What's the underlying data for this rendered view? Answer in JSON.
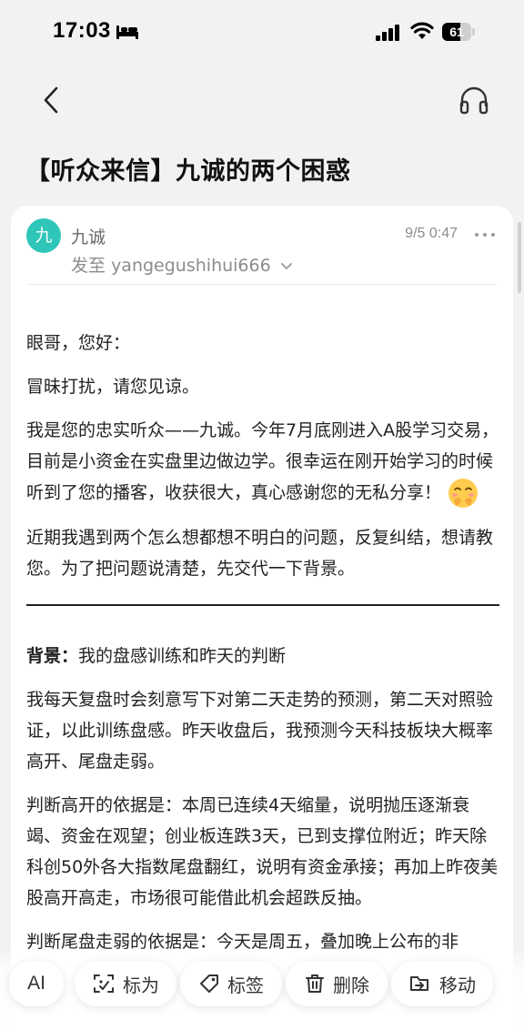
{
  "status": {
    "time": "17:03",
    "battery_percent": "61",
    "battery_level": 0.61
  },
  "header": {
    "back_icon": "chevron-left-icon",
    "audio_icon": "headphones-icon"
  },
  "title": "【听众来信】九诚的两个困惑",
  "email": {
    "avatar_letter": "九",
    "sender": "九诚",
    "recipient_prefix": "发至",
    "recipient": "yangegushihui666",
    "time": "9/5 0:47"
  },
  "body": {
    "greeting": "眼哥，您好：",
    "p1": "冒昧打扰，请您见谅。",
    "p2": "我是您的忠实听众——九诚。今年7月底刚进入A股学习交易，目前是小资金在实盘里边做边学。很幸运在刚开始学习的时候听到了您的播客，收获很大，真心感谢您的无私分享！",
    "p3": "近期我遇到两个怎么想都想不明白的问题，反复纠结，想请教您。为了把问题说清楚，先交代一下背景。",
    "bg_label": "背景：",
    "bg_title": "我的盘感训练和昨天的判断",
    "p4": "我每天复盘时会刻意写下对第二天走势的预测，第二天对照验证，以此训练盘感。昨天收盘后，我预测今天科技板块大概率高开、尾盘走弱。",
    "p5": "判断高开的依据是：本周已连续4天缩量，说明抛压逐渐衰竭、资金在观望；创业板连跌3天，已到支撑位附近；昨天除科创50外各大指数尾盘翻红，说明有资金承接；再加上昨夜美股高开高走，市场很可能借此机会超跌反抽。",
    "p6": "判断尾盘走弱的依据是：今天是周五，叠加晚上公布的非"
  },
  "toolbar": {
    "ai_label": "AI",
    "mark_label": "标为",
    "tag_label": "标签",
    "delete_label": "删除",
    "move_label": "移动"
  }
}
